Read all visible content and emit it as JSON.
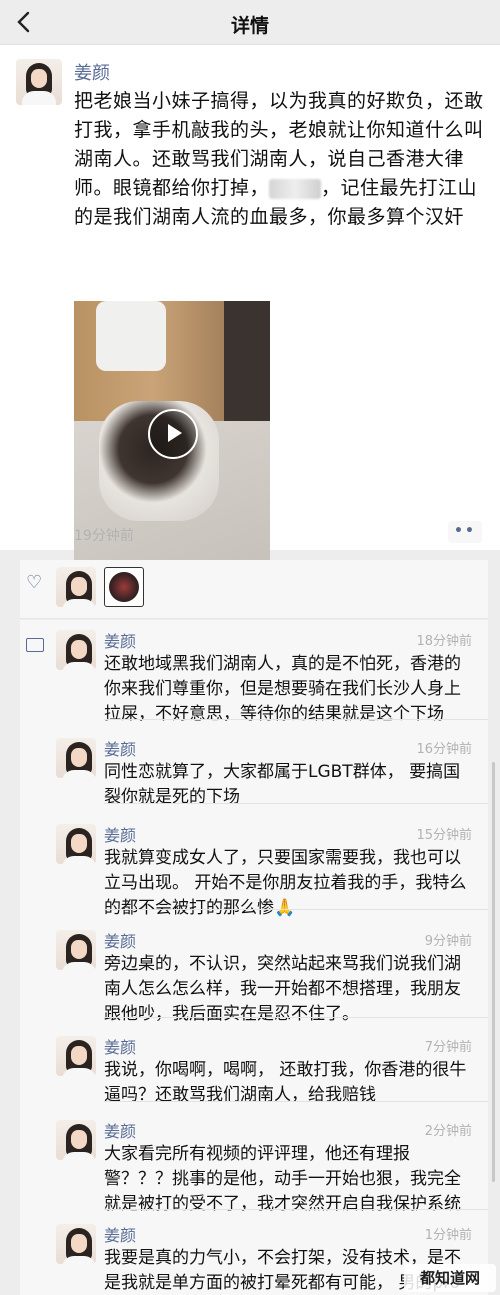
{
  "nav": {
    "back_icon": "chevron-left-icon",
    "title": "详情"
  },
  "post": {
    "author": "姜颜",
    "text_before_blur": "把老娘当小妹子搞得，以为我真的好欺负，还敢打我，拿手机敲我的头，老娘就让你知道什么叫湖南人。还敢骂我们湖南人，说自己香港大律师。眼镜都给你打掉，",
    "text_after_blur": "，记住最先打江山的是我们湖南人流的血最多，你最多算个汉奸",
    "time": "19分钟前",
    "more_label": "••"
  },
  "likes": {
    "heart_icon": "heart-outline-icon"
  },
  "comments": [
    {
      "name": "姜颜",
      "time": "18分钟前",
      "text": "还敢地域黑我们湖南人，真的是不怕死，香港的你来我们尊重你，但是想要骑在我们长沙人身上拉屎，不好意思，等待你的结果就是这个下场"
    },
    {
      "name": "姜颜",
      "time": "16分钟前",
      "text": "同性恋就算了，大家都属于LGBT群体，    要搞国    裂你就是死的下场"
    },
    {
      "name": "姜颜",
      "time": "15分钟前",
      "text": "我就算变成女人了，只要国家需要我，我也可以立马出现。     开始不是你朋友拉着我的手，我特么的都不会被打的那么惨🙏"
    },
    {
      "name": "姜颜",
      "time": "9分钟前",
      "text": "旁边桌的，不认识，突然站起来骂我们说我们湖南人怎么怎么样，我一开始都不想搭理，我朋友跟他吵，我后面实在是忍不住了。"
    },
    {
      "name": "姜颜",
      "time": "7分钟前",
      "text": "我说，你喝啊，喝啊，       还敢打我，你香港的很牛逼吗？还敢骂我们湖南人，给我赔钱"
    },
    {
      "name": "姜颜",
      "time": "2分钟前",
      "text": "大家看完所有视频的评评理，他还有理报警？？？挑事的是他，动手一开始也狠，我完全就是被打的受不了，我才突然开启自我保护系统"
    },
    {
      "name": "姜颜",
      "time": "1分钟前",
      "text": "我要是真的力气小，不会打架，没有技术，是不是我就是单方面的被打晕死都有可能，   男的pro max有多香啊？连续敲我的"
    }
  ],
  "watermark": "都知道网"
}
